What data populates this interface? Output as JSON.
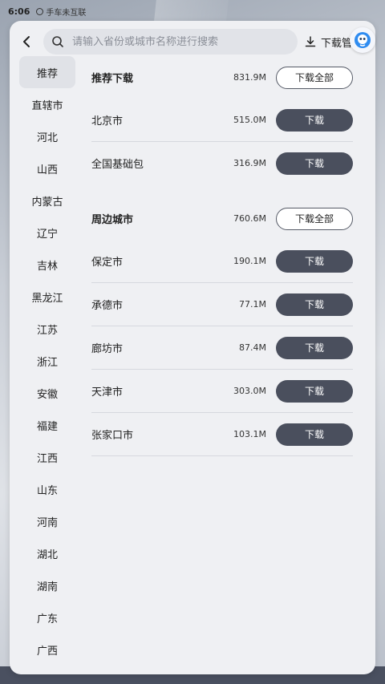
{
  "status": {
    "time": "6:06",
    "network": "手车未互联"
  },
  "search": {
    "placeholder": "请输入省份或城市名称进行搜索"
  },
  "download_manager": {
    "label": "下载管理"
  },
  "sidebar": {
    "items": [
      {
        "label": "推荐",
        "active": true
      },
      {
        "label": "直辖市"
      },
      {
        "label": "河北"
      },
      {
        "label": "山西"
      },
      {
        "label": "内蒙古"
      },
      {
        "label": "辽宁"
      },
      {
        "label": "吉林"
      },
      {
        "label": "黑龙江"
      },
      {
        "label": "江苏"
      },
      {
        "label": "浙江"
      },
      {
        "label": "安徽"
      },
      {
        "label": "福建"
      },
      {
        "label": "江西"
      },
      {
        "label": "山东"
      },
      {
        "label": "河南"
      },
      {
        "label": "湖北"
      },
      {
        "label": "湖南"
      },
      {
        "label": "广东"
      },
      {
        "label": "广西"
      }
    ]
  },
  "sections": [
    {
      "header": {
        "name": "推荐下载",
        "size": "831.9M",
        "button": "下载全部"
      },
      "rows": [
        {
          "name": "北京市",
          "size": "515.0M",
          "button": "下载"
        },
        {
          "name": "全国基础包",
          "size": "316.9M",
          "button": "下载"
        }
      ]
    },
    {
      "header": {
        "name": "周边城市",
        "size": "760.6M",
        "button": "下载全部"
      },
      "rows": [
        {
          "name": "保定市",
          "size": "190.1M",
          "button": "下载"
        },
        {
          "name": "承德市",
          "size": "77.1M",
          "button": "下载"
        },
        {
          "name": "廊坊市",
          "size": "87.4M",
          "button": "下载"
        },
        {
          "name": "天津市",
          "size": "303.0M",
          "button": "下载"
        },
        {
          "name": "张家口市",
          "size": "103.1M",
          "button": "下载"
        }
      ]
    }
  ],
  "colors": {
    "panel": "#eff0f3",
    "dark_button": "#4a4f5d",
    "active_item": "#e0e2e7"
  }
}
